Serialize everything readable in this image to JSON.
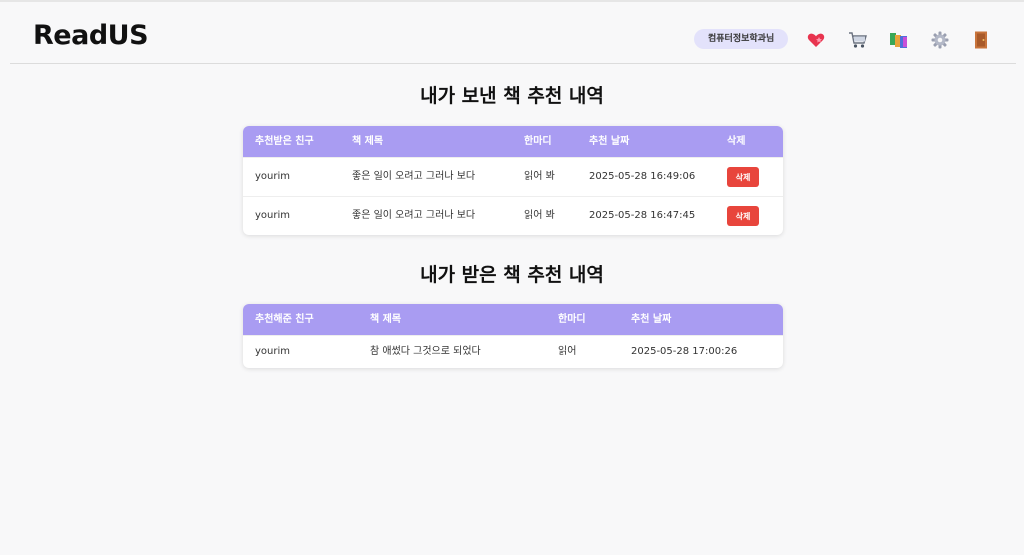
{
  "header": {
    "brand": "ReadUS",
    "user_label": "컴퓨터정보학과님",
    "icons": [
      "heart-icon",
      "cart-icon",
      "books-icon",
      "gear-icon",
      "door-icon"
    ]
  },
  "sent": {
    "title": "내가 보낸 책 추천 내역",
    "columns": {
      "friend": "추천받은 친구",
      "book": "책 제목",
      "comment": "한마디",
      "date": "추천 날짜",
      "delete": "삭제"
    },
    "rows": [
      {
        "friend": "yourim",
        "book": "좋은 일이 오려고 그러나 보다",
        "comment": "읽어 봐",
        "date": "2025-05-28 16:49:06",
        "delete_label": "삭제"
      },
      {
        "friend": "yourim",
        "book": "좋은 일이 오려고 그러나 보다",
        "comment": "읽어 봐",
        "date": "2025-05-28 16:47:45",
        "delete_label": "삭제"
      }
    ]
  },
  "received": {
    "title": "내가 받은 책 추천 내역",
    "columns": {
      "friend": "추천해준 친구",
      "book": "책 제목",
      "comment": "한마디",
      "date": "추천 날짜"
    },
    "rows": [
      {
        "friend": "yourim",
        "book": "참 애썼다 그것으로 되었다",
        "comment": "읽어",
        "date": "2025-05-28 17:00:26"
      }
    ]
  },
  "colors": {
    "header_bg": "#a99cf2",
    "delete_bg": "#e8453c",
    "badge_bg": "#e3e2fb"
  }
}
